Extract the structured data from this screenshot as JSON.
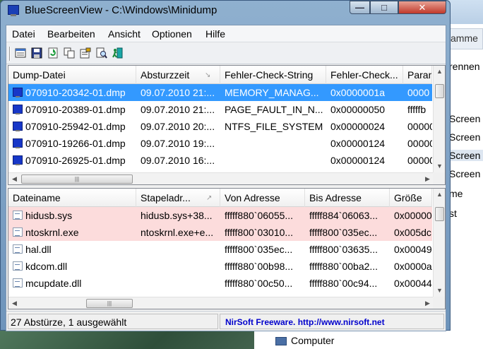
{
  "window": {
    "title": "BlueScreenView  -  C:\\Windows\\Minidump",
    "min_label": "—",
    "max_label": "□",
    "close_label": "✕"
  },
  "menu": [
    "Datei",
    "Bearbeiten",
    "Ansicht",
    "Optionen",
    "Hilfe"
  ],
  "toolbar": {
    "icons": [
      "html-report-icon",
      "save-icon",
      "refresh-icon",
      "copy-icon",
      "properties-icon",
      "find-icon",
      "exit-icon"
    ]
  },
  "top_list": {
    "columns": [
      "Dump-Datei",
      "Absturzzeit",
      "Fehler-Check-String",
      "Fehler-Check...",
      "Paran"
    ],
    "rows": [
      {
        "file": "070910-20342-01.dmp",
        "time": "09.07.2010 21:...",
        "check_string": "MEMORY_MANAG...",
        "check_code": "0x0000001a",
        "param": "0000",
        "selected": true
      },
      {
        "file": "070910-20389-01.dmp",
        "time": "09.07.2010 21:...",
        "check_string": "PAGE_FAULT_IN_N...",
        "check_code": "0x00000050",
        "param": "fffffb",
        "selected": false
      },
      {
        "file": "070910-25942-01.dmp",
        "time": "09.07.2010 20:...",
        "check_string": "NTFS_FILE_SYSTEM",
        "check_code": "0x00000024",
        "param": "00000",
        "selected": false
      },
      {
        "file": "070910-19266-01.dmp",
        "time": "09.07.2010 19:...",
        "check_string": "",
        "check_code": "0x00000124",
        "param": "00000",
        "selected": false
      },
      {
        "file": "070910-26925-01.dmp",
        "time": "09.07.2010 16:...",
        "check_string": "",
        "check_code": "0x00000124",
        "param": "00000",
        "selected": false
      }
    ]
  },
  "bottom_list": {
    "columns": [
      "Dateiname",
      "Stapeladr...",
      "Von Adresse",
      "Bis Adresse",
      "Größe"
    ],
    "rows": [
      {
        "name": "hidusb.sys",
        "stack": "hidusb.sys+38...",
        "from": "fffff880`06055...",
        "to": "fffff884`06063...",
        "size": "0x00000",
        "highlight": true
      },
      {
        "name": "ntoskrnl.exe",
        "stack": "ntoskrnl.exe+e...",
        "from": "fffff800`03010...",
        "to": "fffff800`035ec...",
        "size": "0x005dc",
        "highlight": true
      },
      {
        "name": "hal.dll",
        "stack": "",
        "from": "fffff800`035ec...",
        "to": "fffff800`03635...",
        "size": "0x00049",
        "highlight": false
      },
      {
        "name": "kdcom.dll",
        "stack": "",
        "from": "fffff880`00b98...",
        "to": "fffff880`00ba2...",
        "size": "0x0000a",
        "highlight": false
      },
      {
        "name": "mcupdate.dll",
        "stack": "",
        "from": "fffff880`00c50...",
        "to": "fffff880`00c94...",
        "size": "0x00044",
        "highlight": false
      }
    ]
  },
  "status": {
    "left": "27 Abstürze, 1 ausgewählt",
    "right": "NirSoft Freeware.  http://www.nirsoft.net"
  },
  "background": {
    "tab_fragment": "amme",
    "line_fragments": [
      "rennen",
      "Screen",
      "Screen",
      "Screen",
      "Screen",
      "me",
      "st"
    ],
    "computer_label": "Computer"
  },
  "colors": {
    "selection": "#3399ff",
    "highlight_row": "#fcdcdc",
    "status_link": "#0000cc"
  }
}
